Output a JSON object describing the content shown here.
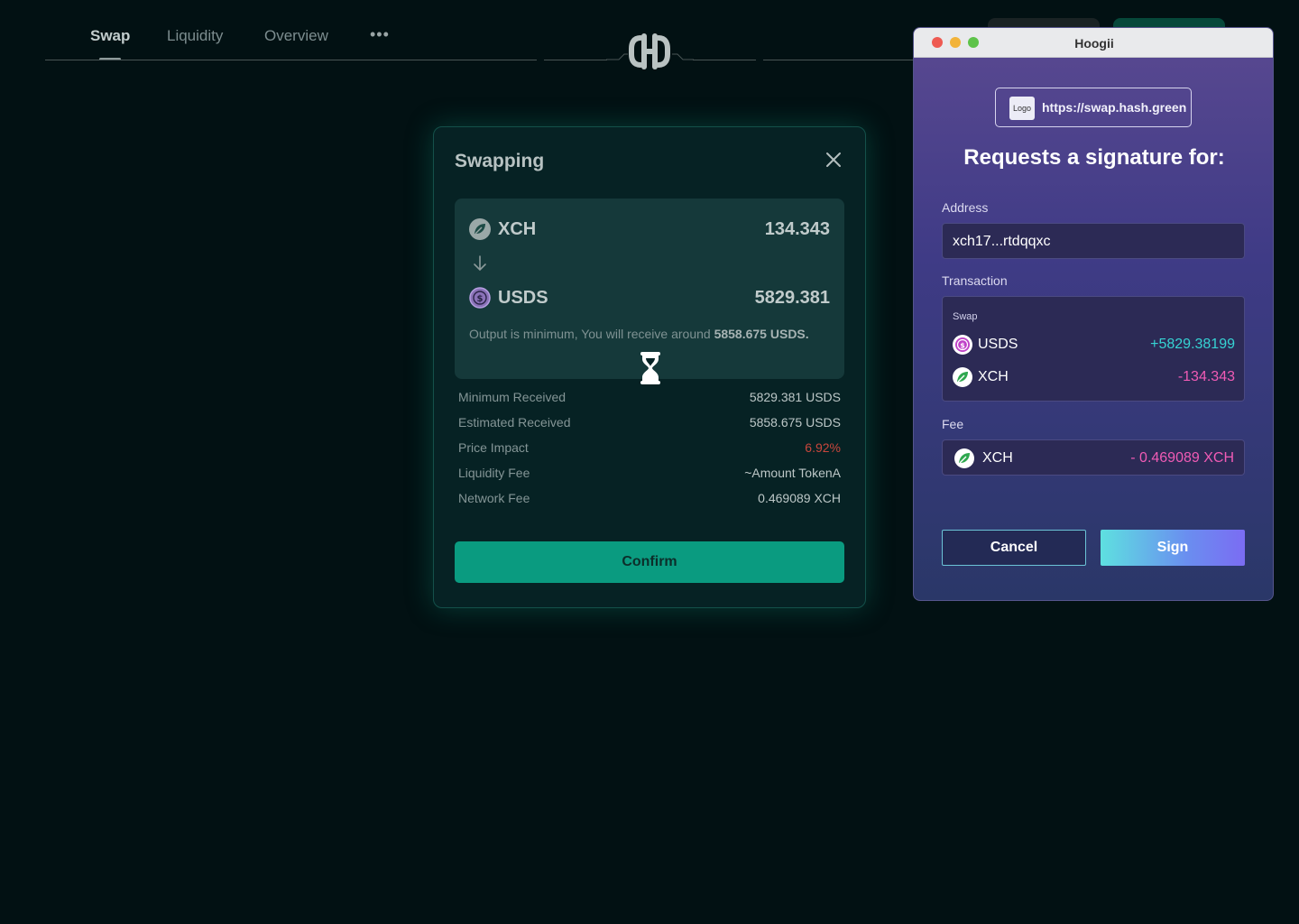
{
  "nav": {
    "tabs": [
      {
        "label": "Swap",
        "active": true
      },
      {
        "label": "Liquidity",
        "active": false
      },
      {
        "label": "Overview",
        "active": false
      }
    ],
    "more": "•••"
  },
  "modal": {
    "title": "Swapping",
    "from": {
      "symbol": "XCH",
      "amount": "134.343",
      "icon": "leaf-token-icon"
    },
    "to": {
      "symbol": "USDS",
      "amount": "5829.381",
      "icon": "dollar-token-icon"
    },
    "note_prefix": "Output is minimum, You will receive around",
    "note_amount": "5858.675",
    "note_suffix": "USDS.",
    "details": [
      {
        "label": "Minimum Received",
        "value": "5829.381 USDS"
      },
      {
        "label": "Estimated Received",
        "value": "5858.675 USDS"
      },
      {
        "label": "Price Impact",
        "value": "6.92%"
      },
      {
        "label": "Liquidity Fee",
        "value": "~Amount TokenA"
      },
      {
        "label": "Network Fee",
        "value": "0.469089 XCH"
      }
    ],
    "confirm_label": "Confirm",
    "colors": {
      "accent": "#0a9b80",
      "negative": "#c8463c"
    }
  },
  "wallet": {
    "window_title": "Hoogii",
    "logo_label": "Logo",
    "url": "https://swap.hash.green",
    "heading": "Requests a signature for:",
    "address_label": "Address",
    "address_value": "xch17...rtdqqxc",
    "transaction_label": "Transaction",
    "transaction_kind": "Swap",
    "transaction_rows": [
      {
        "symbol": "USDS",
        "value": "+5829.38199"
      },
      {
        "symbol": "XCH",
        "value": "-134.343"
      }
    ],
    "fee_label": "Fee",
    "fee_symbol": "XCH",
    "fee_value": "- 0.469089 XCH",
    "cancel_label": "Cancel",
    "sign_label": "Sign",
    "colors": {
      "positive": "#36d3d3",
      "negative": "#f05bb5"
    }
  }
}
